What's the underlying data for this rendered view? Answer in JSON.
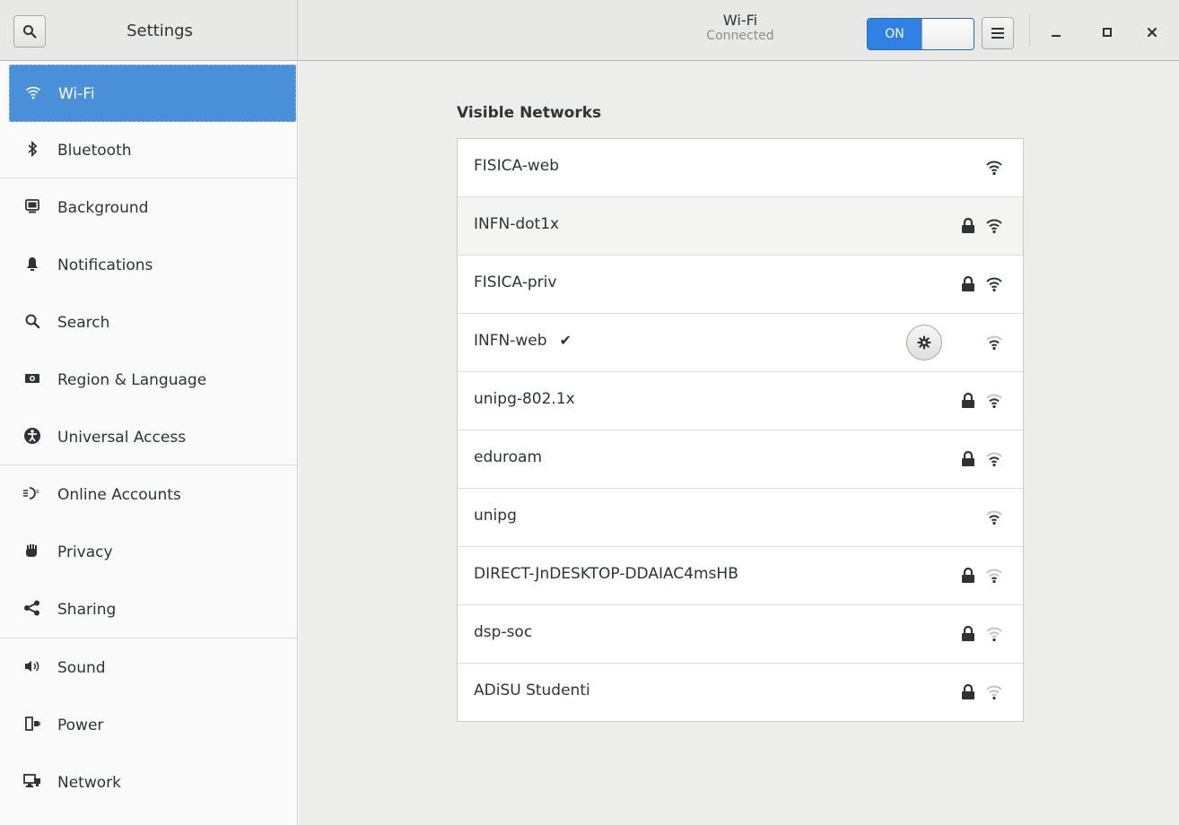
{
  "header": {
    "search_icon": "search-icon",
    "left_title": "Settings",
    "title": "Wi-Fi",
    "subtitle": "Connected",
    "switch_label": "ON",
    "switch_state": "on",
    "accent_color": "#3081e3"
  },
  "sidebar": {
    "selected_color": "#4a90d9",
    "items": [
      {
        "label": "Wi-Fi",
        "icon": "wifi-icon"
      },
      {
        "label": "Bluetooth",
        "icon": "bluetooth-icon"
      },
      {
        "label": "Background",
        "icon": "background-icon"
      },
      {
        "label": "Notifications",
        "icon": "bell-icon"
      },
      {
        "label": "Search",
        "icon": "search-icon"
      },
      {
        "label": "Region & Language",
        "icon": "region-icon"
      },
      {
        "label": "Universal Access",
        "icon": "accessibility-icon"
      },
      {
        "label": "Online Accounts",
        "icon": "online-accounts-icon"
      },
      {
        "label": "Privacy",
        "icon": "privacy-hand-icon"
      },
      {
        "label": "Sharing",
        "icon": "share-icon"
      },
      {
        "label": "Sound",
        "icon": "speaker-icon"
      },
      {
        "label": "Power",
        "icon": "power-icon"
      },
      {
        "label": "Network",
        "icon": "network-icon"
      }
    ]
  },
  "main": {
    "section_title": "Visible Networks",
    "networks": [
      {
        "name": "FISICA-web",
        "secured": false,
        "signal": "excellent"
      },
      {
        "name": "INFN-dot1x",
        "secured": true,
        "signal": "excellent"
      },
      {
        "name": "FISICA-priv",
        "secured": true,
        "signal": "excellent"
      },
      {
        "name": "INFN-web",
        "secured": false,
        "signal": "good",
        "connected": true,
        "check": "✔"
      },
      {
        "name": "unipg-802.1x",
        "secured": true,
        "signal": "good"
      },
      {
        "name": "eduroam",
        "secured": true,
        "signal": "good"
      },
      {
        "name": "unipg",
        "secured": false,
        "signal": "good"
      },
      {
        "name": "DIRECT-JnDESKTOP-DDAIAC4msHB",
        "secured": true,
        "signal": "ok"
      },
      {
        "name": "dsp-soc",
        "secured": true,
        "signal": "weak"
      },
      {
        "name": "ADiSU Studenti",
        "secured": true,
        "signal": "weak"
      }
    ]
  }
}
